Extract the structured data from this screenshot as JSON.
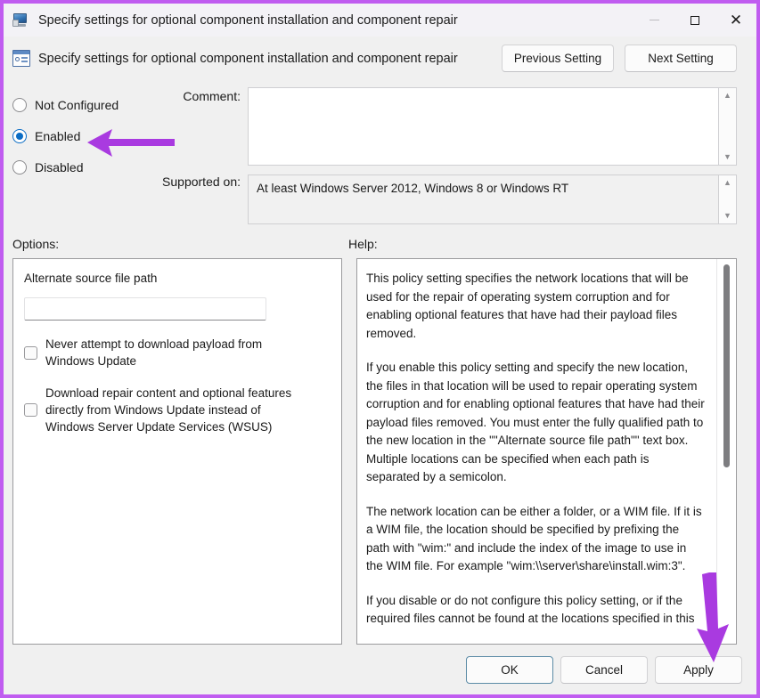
{
  "window": {
    "title": "Specify settings for optional component installation and component repair",
    "title_icon": "policy-monitor-icon",
    "controls": {
      "minimize": "minimize-icon",
      "maximize": "maximize-icon",
      "close": "close-icon"
    }
  },
  "header": {
    "icon": "policy-setting-icon",
    "setting_name": "Specify settings for optional component installation and component repair",
    "previous_button": "Previous Setting",
    "next_button": "Next Setting"
  },
  "state": {
    "options": [
      {
        "label": "Not Configured",
        "selected": false
      },
      {
        "label": "Enabled",
        "selected": true
      },
      {
        "label": "Disabled",
        "selected": false
      }
    ],
    "comment_label": "Comment:",
    "comment_value": "",
    "supported_label": "Supported on:",
    "supported_value": "At least Windows Server 2012, Windows 8 or Windows RT"
  },
  "options_panel": {
    "section_label": "Options:",
    "field_label": "Alternate source file path",
    "field_value": "",
    "field_placeholder": "",
    "checkboxes": [
      {
        "label": "Never attempt to download payload from Windows Update",
        "checked": false
      },
      {
        "label": "Download repair content and optional features directly from Windows Update instead of Windows Server Update Services (WSUS)",
        "checked": false
      }
    ]
  },
  "help_panel": {
    "section_label": "Help:",
    "paragraphs": [
      "This policy setting specifies the network locations that will be used for the repair of operating system corruption and for enabling optional features that have had their payload files removed.",
      "If you enable this policy setting and specify the new location, the files in that location will be used to repair operating system corruption and for enabling optional features that have had their payload files removed. You must enter the fully qualified path to the new location in the \"\"Alternate source file path\"\" text box. Multiple locations can be specified when each path is separated by a semicolon.",
      "The network location can be either a folder, or a WIM file. If it is a WIM file, the location should be specified by prefixing the path with \"wim:\" and include the index of the image to use in the WIM file. For example \"wim:\\\\server\\share\\install.wim:3\".",
      "If you disable or do not configure this policy setting, or if the required files cannot be found at the locations specified in this"
    ]
  },
  "footer": {
    "ok": "OK",
    "cancel": "Cancel",
    "apply": "Apply"
  },
  "annotations": {
    "accent_color": "#a93ae0",
    "border_color": "#c05cf0",
    "arrow_to_enabled": "arrow-left-icon",
    "arrow_to_apply": "arrow-down-icon"
  }
}
